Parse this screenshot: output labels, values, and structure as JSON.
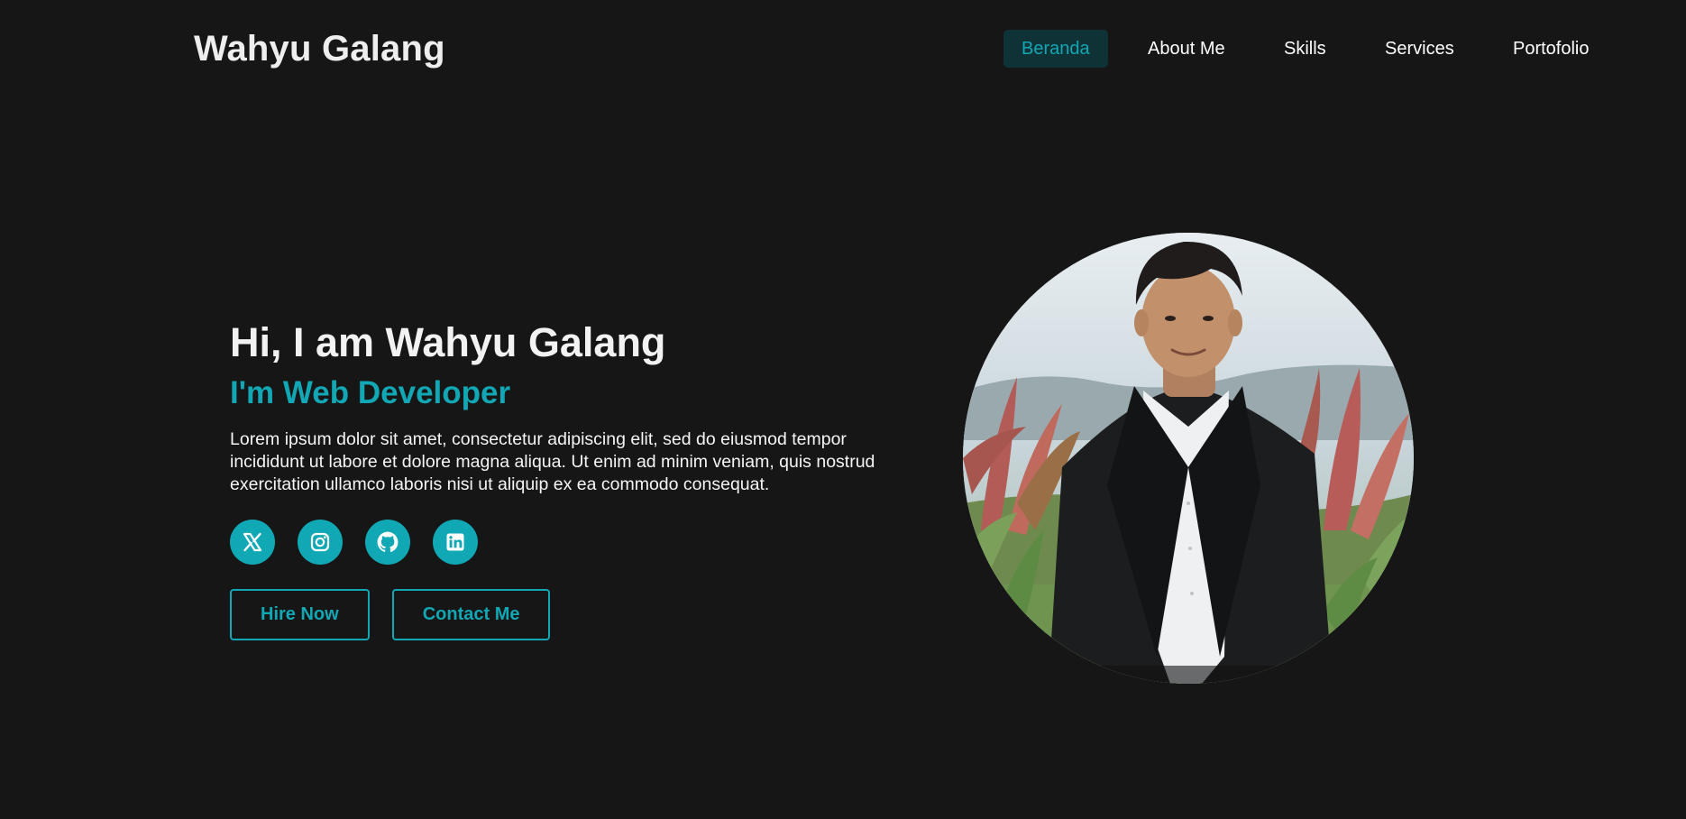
{
  "header": {
    "logo": "Wahyu Galang",
    "nav": [
      {
        "label": "Beranda",
        "active": true
      },
      {
        "label": "About Me",
        "active": false
      },
      {
        "label": "Skills",
        "active": false
      },
      {
        "label": "Services",
        "active": false
      },
      {
        "label": "Portofolio",
        "active": false
      }
    ]
  },
  "hero": {
    "title": "Hi, I am Wahyu Galang",
    "subtitle": "I'm Web Developer",
    "description": "Lorem ipsum dolor sit amet, consectetur adipiscing elit, sed do eiusmod tempor incididunt ut labore et dolore magna aliqua. Ut enim ad minim veniam, quis nostrud exercitation ullamco laboris nisi ut aliquip ex ea commodo consequat.",
    "socials": [
      {
        "icon": "x-twitter-icon"
      },
      {
        "icon": "instagram-icon"
      },
      {
        "icon": "github-icon"
      },
      {
        "icon": "linkedin-icon"
      }
    ],
    "buttons": {
      "hire": "Hire Now",
      "contact": "Contact Me"
    }
  },
  "colors": {
    "background": "#161616",
    "accent": "#12a7b4",
    "nav_active_bg": "#0f3236",
    "text": "#f2f2f2"
  }
}
